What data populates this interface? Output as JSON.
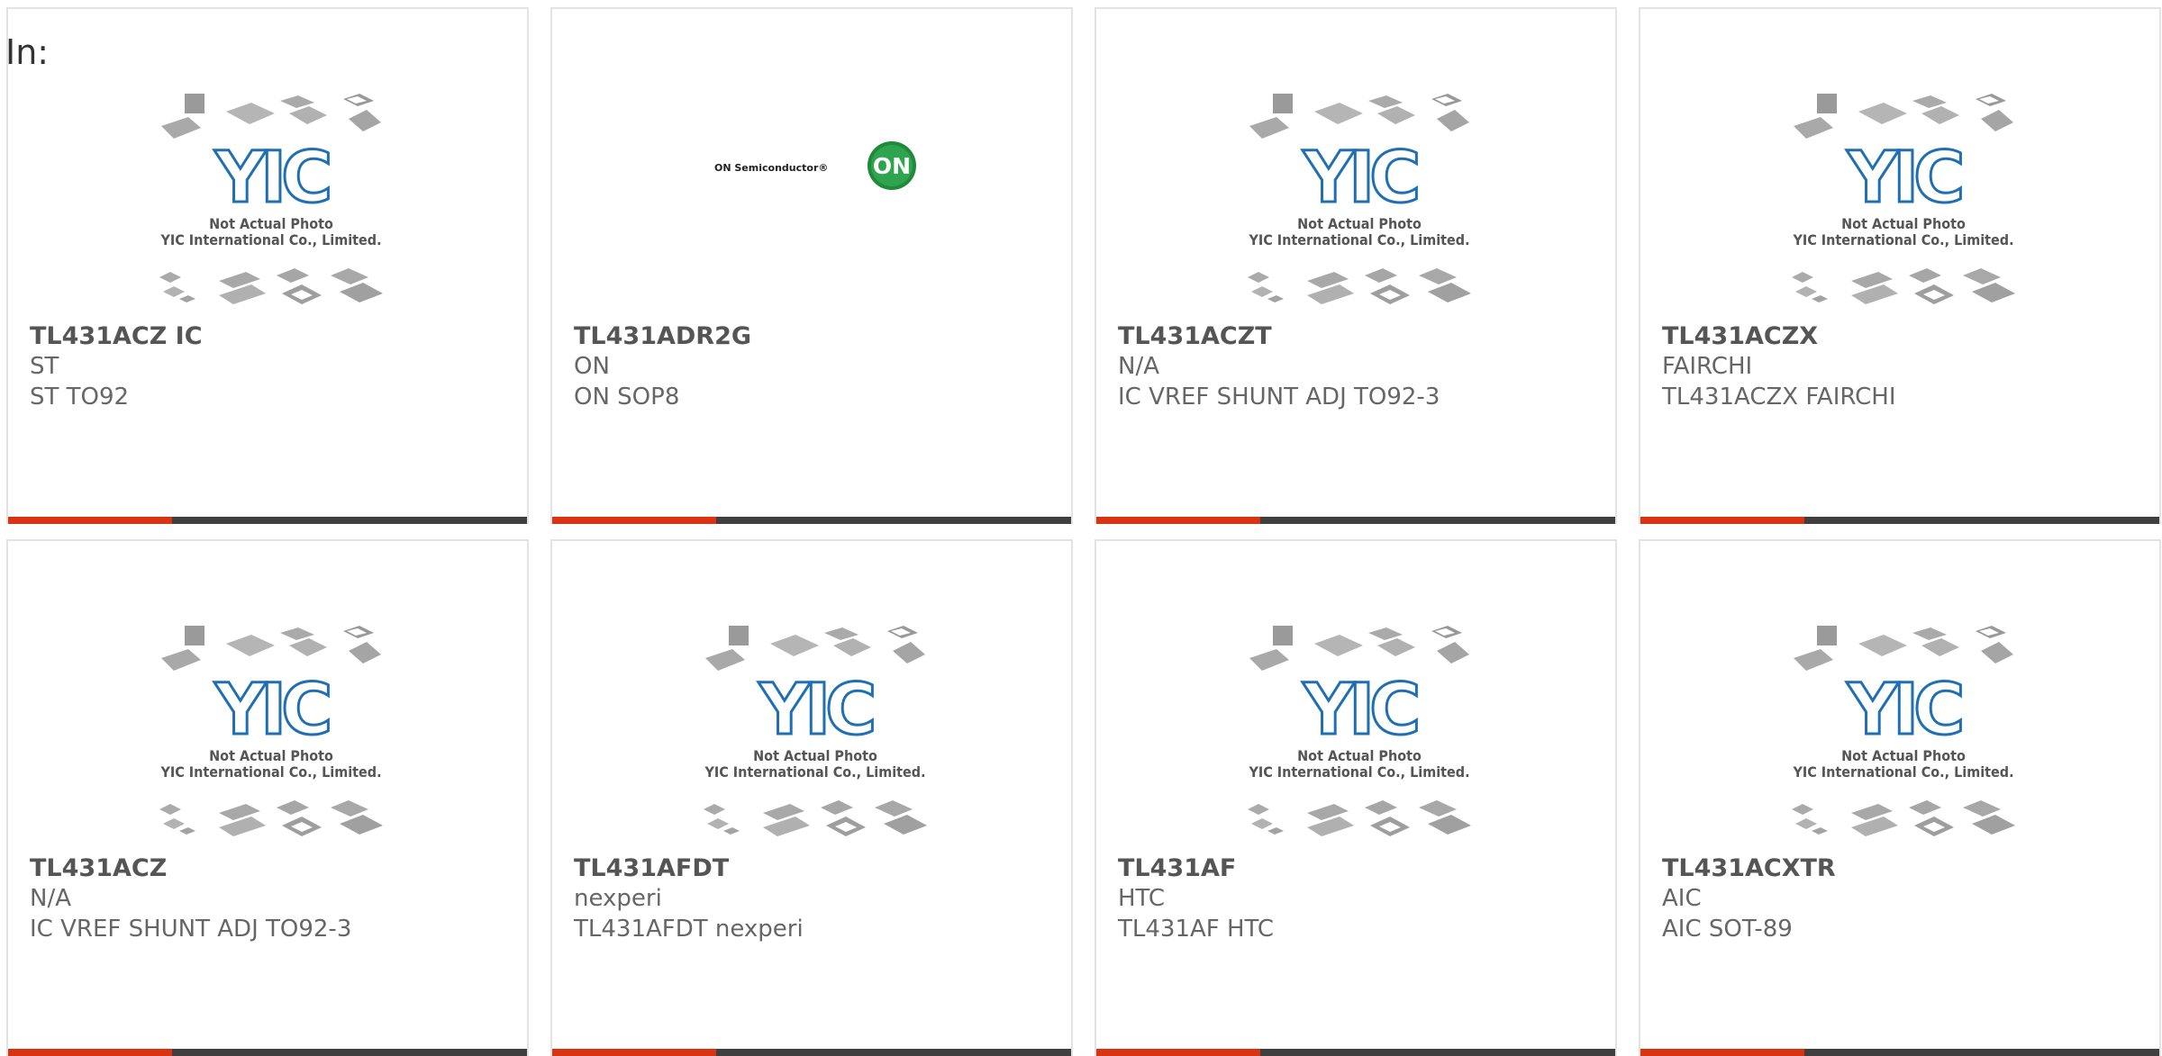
{
  "page": {
    "label": "In:"
  },
  "watermark": {
    "line1": "Not Actual Photo",
    "line2": "YIC International Co., Limited.",
    "logo_text": "YIC"
  },
  "on_logo": {
    "text": "ON Semiconductor®",
    "badge": "ON"
  },
  "colors": {
    "accent": "#d83412",
    "bar": "#3f3f3f",
    "title": "#555555",
    "text": "#666666",
    "logo_blue": "#1f6fb2",
    "on_green": "#1f8a3b"
  },
  "products": [
    {
      "part": "TL431ACZ IC",
      "brand": "ST",
      "description": "ST TO92",
      "image": "yic-placeholder"
    },
    {
      "part": "TL431ADR2G",
      "brand": "ON",
      "description": "ON SOP8",
      "image": "on-semiconductor-logo"
    },
    {
      "part": "TL431ACZT",
      "brand": "N/A",
      "description": "IC VREF SHUNT ADJ TO92-3",
      "image": "yic-placeholder"
    },
    {
      "part": "TL431ACZX",
      "brand": "FAIRCHI",
      "description": "TL431ACZX FAIRCHI",
      "image": "yic-placeholder"
    },
    {
      "part": "TL431ACZ",
      "brand": "N/A",
      "description": "IC VREF SHUNT ADJ TO92-3",
      "image": "yic-placeholder"
    },
    {
      "part": "TL431AFDT",
      "brand": "nexperi",
      "description": "TL431AFDT nexperi",
      "image": "yic-placeholder"
    },
    {
      "part": "TL431AF",
      "brand": "HTC",
      "description": "TL431AF HTC",
      "image": "yic-placeholder"
    },
    {
      "part": "TL431ACXTR",
      "brand": "AIC",
      "description": "AIC SOT-89",
      "image": "yic-placeholder"
    }
  ]
}
